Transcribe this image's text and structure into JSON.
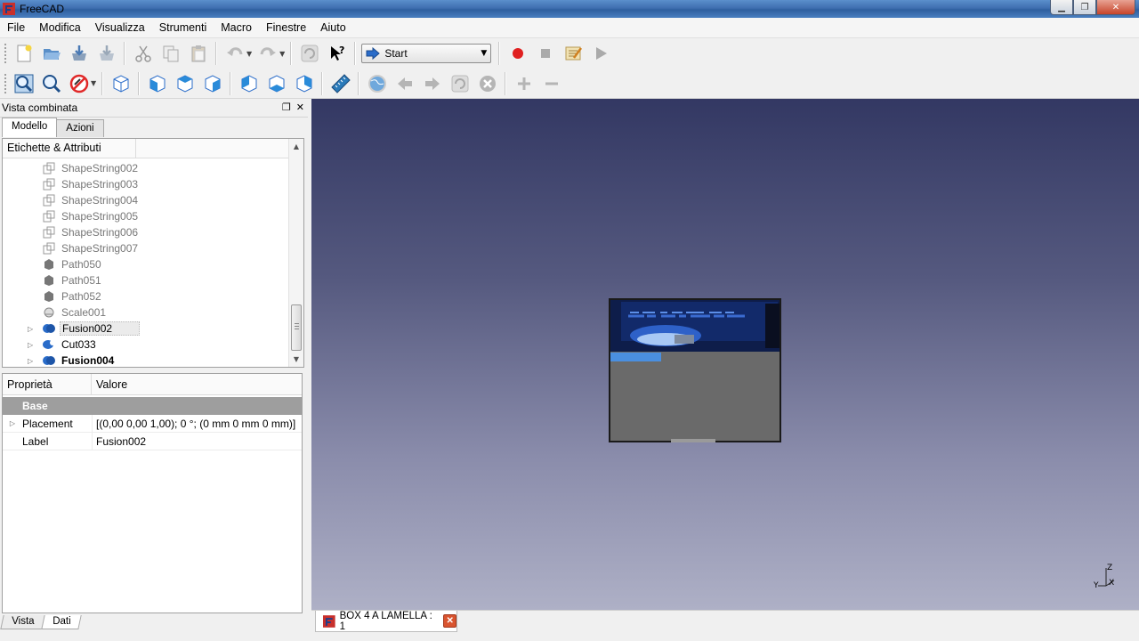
{
  "window": {
    "title": "FreeCAD",
    "buttons": [
      "minimize",
      "maximize",
      "close"
    ]
  },
  "menubar": {
    "items": [
      "File",
      "Modifica",
      "Visualizza",
      "Strumenti",
      "Macro",
      "Finestre",
      "Aiuto"
    ]
  },
  "toolbar1": {
    "icons": [
      "new-document-icon",
      "open-icon",
      "save-icon",
      "save-as-icon",
      "cut-icon",
      "copy-icon",
      "paste-icon",
      "undo-icon",
      "redo-icon",
      "refresh-icon",
      "whats-this-icon"
    ],
    "workbench": {
      "selected": "Start"
    },
    "macro_icons": [
      "record-macro-icon",
      "stop-macro-icon",
      "edit-macro-icon",
      "run-macro-icon"
    ]
  },
  "toolbar2": {
    "icons": [
      "fit-all-icon",
      "fit-selection-icon",
      "draw-style-icon",
      "isometric-view-icon",
      "front-view-icon",
      "top-view-icon",
      "right-view-icon",
      "rear-view-icon",
      "bottom-view-icon",
      "left-view-icon",
      "measure-distance-icon",
      "web-icon",
      "back-icon",
      "forward-icon",
      "reload-icon",
      "stop-icon",
      "zoom-in-icon",
      "zoom-out-icon"
    ]
  },
  "combo": {
    "title": "Vista combinata",
    "tabs": [
      "Modello",
      "Azioni"
    ],
    "active_tab": "Modello",
    "tree_header": "Etichette & Attributi",
    "tree_items": [
      {
        "label": "ShapeString002",
        "icon": "shapestring-icon",
        "state": "hidden"
      },
      {
        "label": "ShapeString003",
        "icon": "shapestring-icon",
        "state": "hidden"
      },
      {
        "label": "ShapeString004",
        "icon": "shapestring-icon",
        "state": "hidden"
      },
      {
        "label": "ShapeString005",
        "icon": "shapestring-icon",
        "state": "hidden"
      },
      {
        "label": "ShapeString006",
        "icon": "shapestring-icon",
        "state": "hidden"
      },
      {
        "label": "ShapeString007",
        "icon": "shapestring-icon",
        "state": "hidden"
      },
      {
        "label": "Path050",
        "icon": "solid-icon",
        "state": "hidden"
      },
      {
        "label": "Path051",
        "icon": "solid-icon",
        "state": "hidden"
      },
      {
        "label": "Path052",
        "icon": "solid-icon",
        "state": "hidden"
      },
      {
        "label": "Scale001",
        "icon": "scale-icon",
        "state": "hidden"
      },
      {
        "label": "Fusion002",
        "icon": "fusion-icon",
        "state": "selected"
      },
      {
        "label": "Cut033",
        "icon": "cut-solid-icon",
        "state": "visible"
      },
      {
        "label": "Fusion004",
        "icon": "fusion-icon",
        "state": "bold"
      }
    ],
    "properties": {
      "col_property": "Proprietà",
      "col_value": "Valore",
      "group": "Base",
      "rows": [
        {
          "name": "Placement",
          "value": "[(0,00 0,00 1,00); 0 °; (0 mm  0 mm  0 mm)]"
        },
        {
          "name": "Label",
          "value": "Fusion002"
        }
      ]
    },
    "bottom_tabs": [
      "Vista",
      "Dati"
    ],
    "active_bottom_tab": "Dati"
  },
  "document_tab": {
    "label": "BOX 4 A LAMELLA : 1"
  },
  "axes": {
    "z": "Z",
    "x": "X",
    "y": "Y"
  },
  "colors": {
    "view_top": "#333863",
    "view_bottom": "#aeb0c6",
    "selection": "#4a8fe0"
  }
}
